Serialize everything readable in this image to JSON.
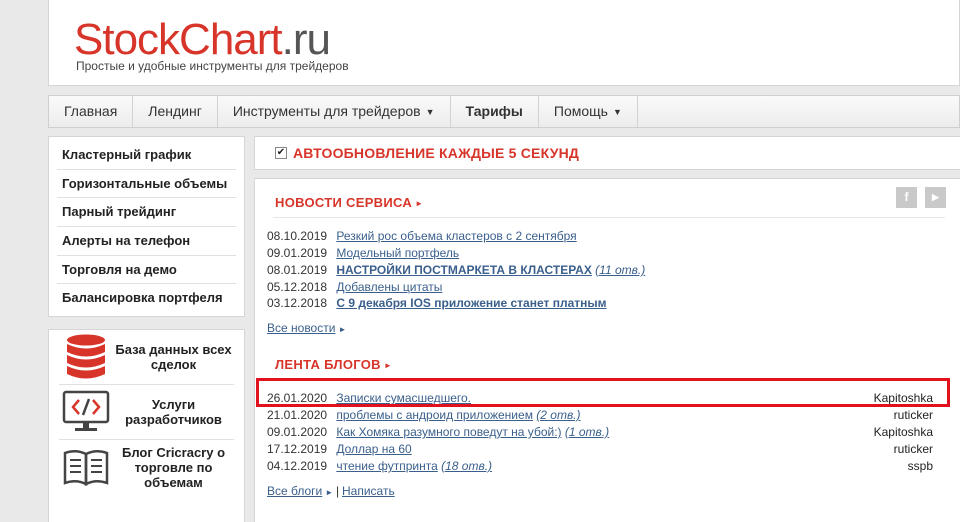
{
  "logo": {
    "part1": "Stock",
    "part2": "Chart",
    "part3": ".ru",
    "tagline": "Простые и удобные инструменты для трейдеров"
  },
  "nav": [
    {
      "label": "Главная"
    },
    {
      "label": "Лендинг"
    },
    {
      "label": "Инструменты для трейдеров"
    },
    {
      "label": "Тарифы"
    },
    {
      "label": "Помощь"
    }
  ],
  "nav_caret": "▼",
  "sidebar": {
    "items": [
      {
        "label": "Кластерный график"
      },
      {
        "label": "Горизонтальные объемы"
      },
      {
        "label": "Парный трейдинг"
      },
      {
        "label": "Алерты на телефон"
      },
      {
        "label": "Торговля на демо"
      },
      {
        "label": "Балансировка портфеля"
      }
    ],
    "services": [
      {
        "label": "База данных всех сделок",
        "icon": "database-icon"
      },
      {
        "label": "Услуги разработчиков",
        "icon": "code-monitor-icon"
      },
      {
        "label": "Блог Cricracry о торговле по объемам",
        "icon": "open-book-icon"
      }
    ]
  },
  "autoupdate": {
    "checkmark": "✔",
    "label": "АВТООБНОВЛЕНИЕ КАЖДЫЕ 5 СЕКУНД"
  },
  "social": {
    "facebook": "f",
    "youtube": "▶"
  },
  "news": {
    "title": "НОВОСТИ СЕРВИСА",
    "arrow": "►",
    "items": [
      {
        "date": "08.10.2019",
        "title": "Резкий рос объема кластеров с 2 сентября",
        "bold": false,
        "count": ""
      },
      {
        "date": "09.01.2019",
        "title": "Модельный портфель",
        "bold": false,
        "count": ""
      },
      {
        "date": "08.01.2019",
        "title": "НАСТРОЙКИ ПОСТМАРКЕТА В КЛАСТЕРАХ",
        "bold": true,
        "count": "(11 отв.)"
      },
      {
        "date": "05.12.2018",
        "title": "Добавлены цитаты",
        "bold": false,
        "count": ""
      },
      {
        "date": "03.12.2018",
        "title": "С 9 декабря IOS приложение станет платным",
        "bold": true,
        "count": ""
      }
    ],
    "more": "Все новости",
    "more_arrow": "►"
  },
  "blogs": {
    "title": "ЛЕНТА БЛОГОВ",
    "arrow": "►",
    "items": [
      {
        "date": "26.01.2020",
        "title": "Записки сумасшедшего.",
        "count": "",
        "author": "Kapitoshka"
      },
      {
        "date": "21.01.2020",
        "title": "проблемы с андроид приложением",
        "count": "(2 отв.)",
        "author": "ruticker"
      },
      {
        "date": "09.01.2020",
        "title": "Как Хомяка разумного поведут на убой:)",
        "count": "(1 отв.)",
        "author": "Kapitoshka"
      },
      {
        "date": "17.12.2019",
        "title": "Доллар на 60",
        "count": "",
        "author": "ruticker"
      },
      {
        "date": "04.12.2019",
        "title": "чтение футпринта",
        "count": "(18 отв.)",
        "author": "sspb"
      }
    ],
    "more": "Все блоги",
    "more_arrow": "►",
    "separator": "|",
    "write": "Написать"
  },
  "colors": {
    "accent": "#d8352a",
    "link": "#3a5f8c",
    "highlight": "#e1121e"
  }
}
